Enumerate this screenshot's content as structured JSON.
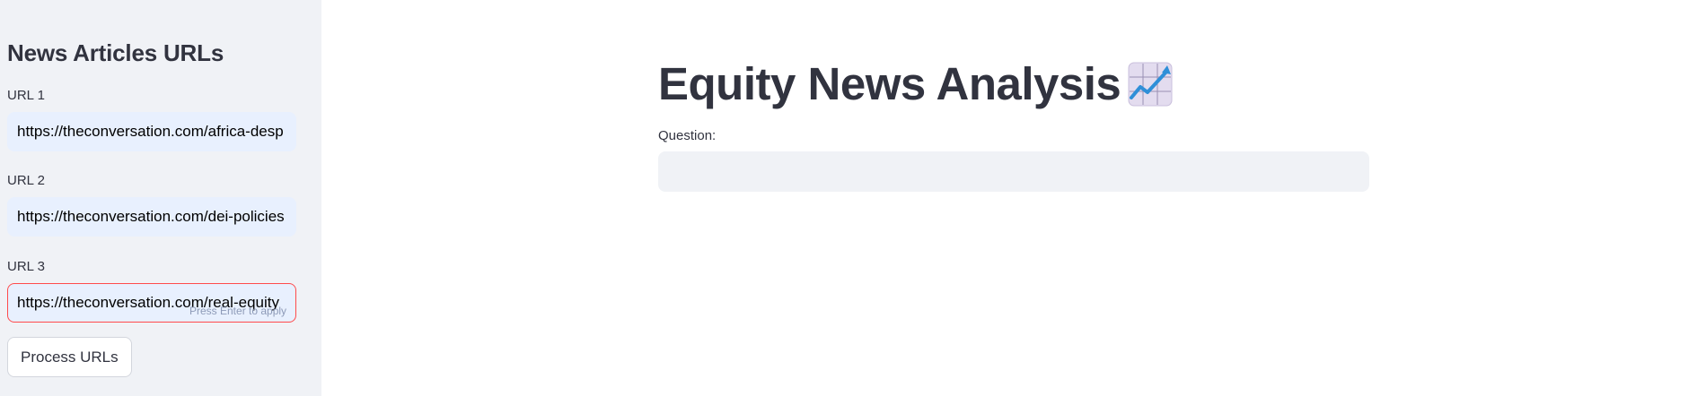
{
  "sidebar": {
    "title": "News Articles URLs",
    "fields": [
      {
        "label": "URL 1",
        "value": "https://theconversation.com/africa-desp"
      },
      {
        "label": "URL 2",
        "value": "https://theconversation.com/dei-policies"
      },
      {
        "label": "URL 3",
        "value": "https://theconversation.com/real-equity"
      }
    ],
    "hint": "Press Enter to apply",
    "process_button": "Process URLs"
  },
  "main": {
    "title": "Equity News Analysis",
    "title_icon": "chart-increasing-icon",
    "question_label": "Question:",
    "question_value": ""
  },
  "colors": {
    "sidebar_bg": "#f0f2f6",
    "input_bg": "#e8f0fe",
    "focus_border": "#ff4b4b",
    "text": "#31333f",
    "hint": "#8e9bb8"
  }
}
